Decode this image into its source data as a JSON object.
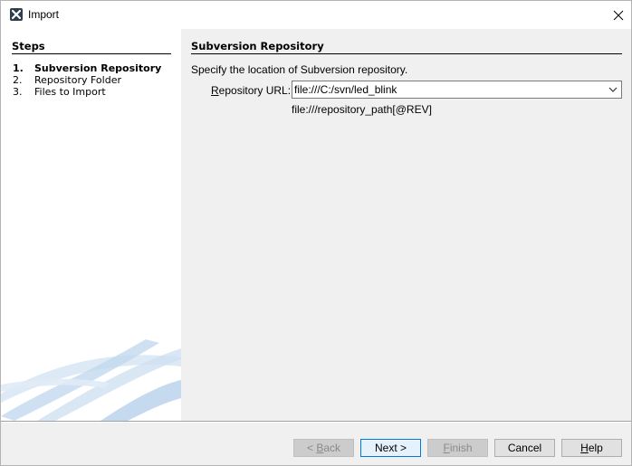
{
  "window": {
    "title": "Import",
    "close_icon": "close-icon",
    "app_icon": "netbeans-icon"
  },
  "steps": {
    "heading": "Steps",
    "items": [
      {
        "num": "1.",
        "label": "Subversion Repository",
        "current": true
      },
      {
        "num": "2.",
        "label": "Repository Folder",
        "current": false
      },
      {
        "num": "3.",
        "label": "Files to Import",
        "current": false
      }
    ]
  },
  "main": {
    "heading": "Subversion Repository",
    "instruction": "Specify the location of Subversion repository.",
    "url_label_underline": "R",
    "url_label_rest": "epository URL:",
    "url_value": "file:///C:/svn/led_blink",
    "url_hint": "file:///repository_path[@REV]"
  },
  "buttons": {
    "back": {
      "prefix": "< ",
      "mnemonic": "B",
      "rest": "ack",
      "enabled": false
    },
    "next": {
      "label": "Next >",
      "enabled": true
    },
    "finish": {
      "mnemonic": "F",
      "rest": "inish",
      "enabled": false
    },
    "cancel": {
      "label": "Cancel",
      "enabled": true
    },
    "help": {
      "mnemonic": "H",
      "rest": "elp",
      "enabled": true
    }
  },
  "colors": {
    "accent": "#0078d7",
    "panel_bg": "#f0f0f0",
    "swoosh": "#c8dcef"
  }
}
